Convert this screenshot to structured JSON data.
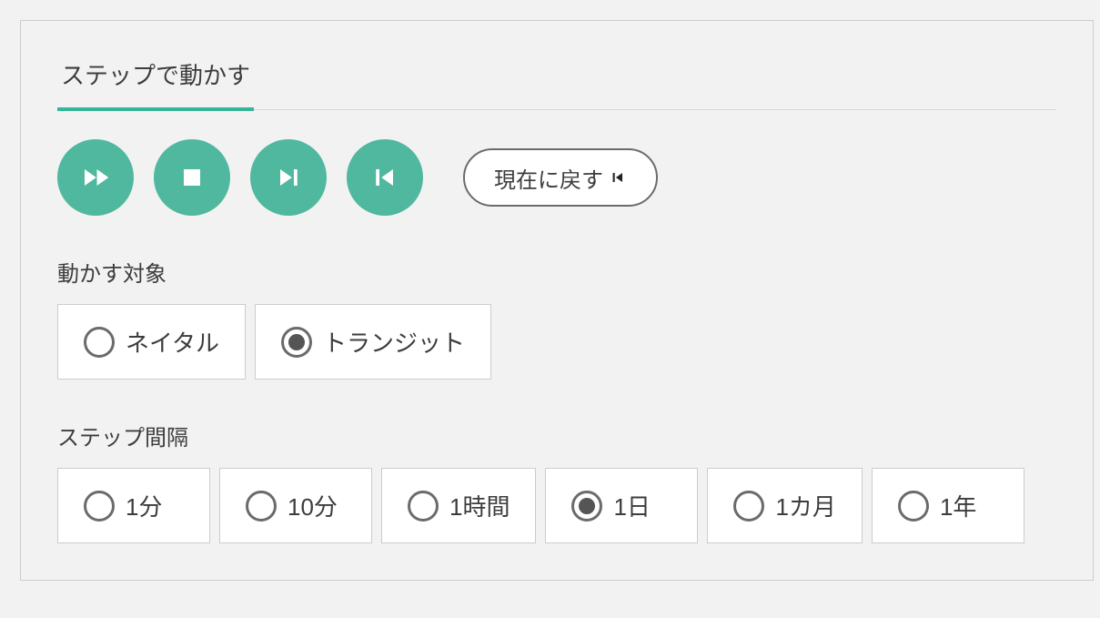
{
  "tab": {
    "label": "ステップで動かす"
  },
  "controls": {
    "fast_forward_icon": "fast-forward-icon",
    "stop_icon": "stop-icon",
    "next_icon": "skip-next-icon",
    "prev_icon": "skip-previous-icon",
    "reset_label": "現在に戻す"
  },
  "target": {
    "label": "動かす対象",
    "options": [
      {
        "label": "ネイタル",
        "selected": false
      },
      {
        "label": "トランジット",
        "selected": true
      }
    ]
  },
  "interval": {
    "label": "ステップ間隔",
    "options": [
      {
        "label": "1分",
        "selected": false
      },
      {
        "label": "10分",
        "selected": false
      },
      {
        "label": "1時間",
        "selected": false
      },
      {
        "label": "1日",
        "selected": true
      },
      {
        "label": "1カ月",
        "selected": false
      },
      {
        "label": "1年",
        "selected": false
      }
    ]
  }
}
